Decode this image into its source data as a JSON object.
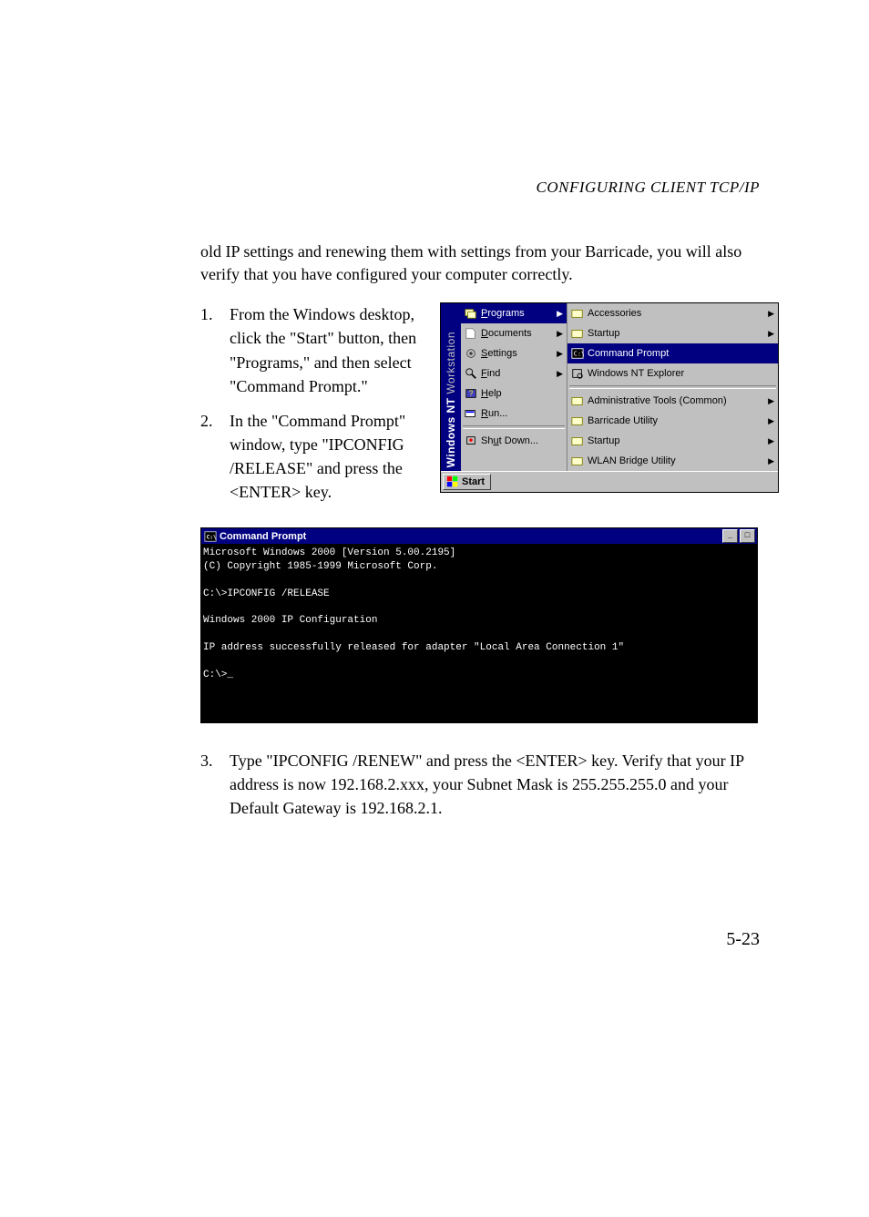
{
  "header": "CONFIGURING CLIENT TCP/IP",
  "intro": "old IP settings and renewing them with settings from your Barricade, you will also verify that you have configured your computer correctly.",
  "steps": {
    "s1": {
      "num": "1.",
      "text": "From the Windows desktop, click the \"Start\" button, then \"Programs,\" and then select \"Command Prompt.\""
    },
    "s2": {
      "num": "2.",
      "text": "In the \"Command Prompt\" window, type \"IPCONFIG /RELEASE\" and press the <ENTER> key."
    },
    "s3": {
      "num": "3.",
      "text": "Type \"IPCONFIG /RENEW\" and press the <ENTER> key. Verify that your IP address is now 192.168.2.xxx, your Subnet Mask is 255.255.255.0 and your Default Gateway is 192.168.2.1."
    }
  },
  "startmenu": {
    "band": "Windows NT",
    "band2": "Workstation",
    "left": {
      "programs": "Programs",
      "documents": "Documents",
      "settings": "Settings",
      "find": "Find",
      "help": "Help",
      "run": "Run...",
      "shutdown": "Shut Down..."
    },
    "right": {
      "accessories": "Accessories",
      "startup": "Startup",
      "cmd": "Command Prompt",
      "explorer": "Windows NT Explorer",
      "admintools": "Administrative Tools (Common)",
      "barricade": "Barricade Utility",
      "startup2": "Startup",
      "wlan": "WLAN Bridge Utility"
    },
    "startbtn": "Start"
  },
  "cmd": {
    "title": "Command Prompt",
    "body": "Microsoft Windows 2000 [Version 5.00.2195]\n(C) Copyright 1985-1999 Microsoft Corp.\n\nC:\\>IPCONFIG /RELEASE\n\nWindows 2000 IP Configuration\n\nIP address successfully released for adapter \"Local Area Connection 1\"\n\nC:\\>_"
  },
  "pagenum": "5-23"
}
